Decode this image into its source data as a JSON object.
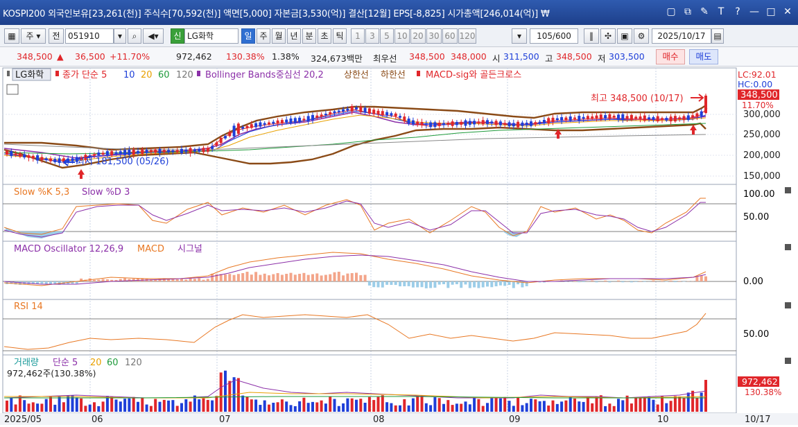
{
  "window": {
    "title": "KOSPI200 외국인보유[23,261(천)] 주식수[70,592(천)] 액면[5,000] 자본금[3,530(억)] 결산[12월] EPS[-8,825] 시가총액[246,014(억)] ₩"
  },
  "toolbar": {
    "period_tab": "주",
    "chart_type": "전",
    "stock_code": "051910",
    "credit_badge": "신",
    "stock_name": "LG화학",
    "intervals": [
      "일",
      "주",
      "월",
      "년",
      "분",
      "초",
      "틱"
    ],
    "active_interval": "일",
    "numbers": [
      "1",
      "3",
      "5",
      "10",
      "20",
      "30",
      "60",
      "120"
    ],
    "count": "105",
    "count_total": "/600",
    "date": "2025/10/17"
  },
  "quote": {
    "price": "348,500",
    "change": "36,500",
    "change_pct": "+11.70%",
    "volume": "972,462",
    "volume_ratio": "130.38%",
    "turnover": "1.38%",
    "amount": "324,673백만",
    "bid_label": "최우선",
    "ask_price": "348,500",
    "bid_price": "348,000",
    "open_label": "시",
    "open": "311,500",
    "high_label": "고",
    "high": "348,500",
    "low_label": "저",
    "low": "303,500",
    "buy_button": "매수",
    "sell_button": "매도"
  },
  "legend": {
    "stock_name": "LG화학",
    "close_ma": "종가 단순 5",
    "ma10": "10",
    "ma20": "20",
    "ma60": "60",
    "ma120": "120",
    "bb": "Bollinger Bands중심선 20,2",
    "bb_upper": "상한선",
    "bb_lower": "하한선",
    "macd_signal": "MACD-sig와 골든크로스",
    "high_note": "최고 348,500 (10/17)",
    "low_note": "최저 181,500 (05/26)",
    "lc": "LC:92.01",
    "hc": "HC:0.00",
    "last_price": "348,500",
    "last_pct": "11.70%"
  },
  "panels": {
    "stoch": "Slow %K 5,3",
    "stoch_d": "Slow %D 3",
    "macd": "MACD Oscillator 12,26,9",
    "macd_line": "MACD",
    "macd_signal": "시그널",
    "rsi": "RSI 14",
    "volume": "거래량",
    "volume_ma": "단순 5",
    "vol20": "20",
    "vol60": "60",
    "vol120": "120",
    "volume_note": "972,462주(130.38%)",
    "volume_last": "972,462",
    "volume_last_pct": "130.38%"
  },
  "axes": {
    "price_ticks": [
      "300,000",
      "250,000",
      "200,000",
      "150,000"
    ],
    "stoch_ticks": [
      "100.00",
      "50.00"
    ],
    "macd_ticks": [
      "0.00"
    ],
    "rsi_ticks": [
      "50.00"
    ],
    "x_ticks": [
      "2025/05",
      "06",
      "07",
      "08",
      "09",
      "10"
    ],
    "x_last": "10/17"
  },
  "colors": {
    "up": "#e0262a",
    "down": "#1e3fd8",
    "bb": "#8a4a16",
    "stoch_k": "#e87722",
    "stoch_d": "#8b2fa8",
    "macd_osc_pos": "#f3a58a",
    "macd_osc_neg": "#9ccde8"
  }
}
